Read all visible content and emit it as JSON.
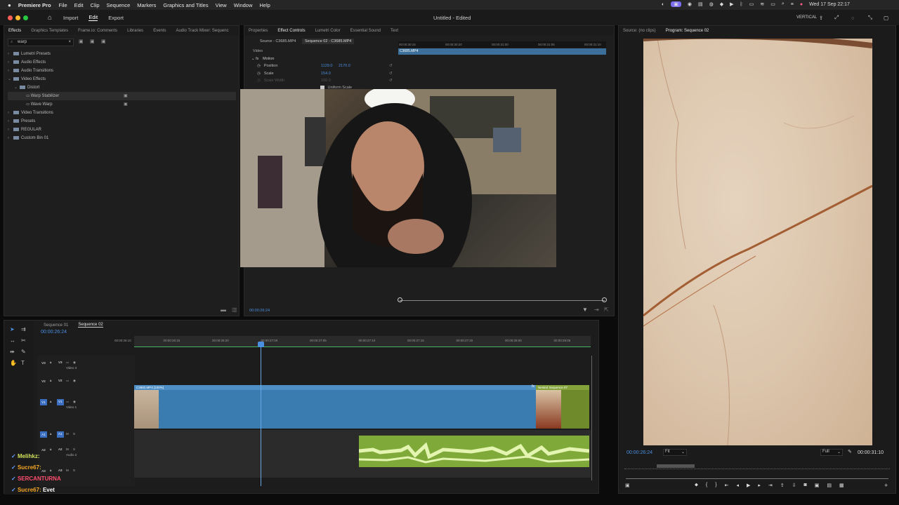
{
  "menubar": {
    "app": "Premiere Pro",
    "items": [
      "File",
      "Edit",
      "Clip",
      "Sequence",
      "Markers",
      "Graphics and Titles",
      "View",
      "Window",
      "Help"
    ],
    "right_label": "VERTICAL",
    "clock": "Wed 17 Sep  22:17"
  },
  "appbar": {
    "tabs": [
      "Import",
      "Edit",
      "Export"
    ],
    "active_tab": "Edit",
    "title": "Untitled - Edited"
  },
  "effects_panel": {
    "tabs": [
      "Effects",
      "Graphics Templates",
      "Frame.io: Comments",
      "Libraries",
      "Events",
      "Audio Track Mixer: Sequenc"
    ],
    "search_value": "warp",
    "tree": [
      {
        "label": "Lumetri Presets",
        "level": 0,
        "type": "folder",
        "open": false
      },
      {
        "label": "Audio Effects",
        "level": 0,
        "type": "folder",
        "open": false
      },
      {
        "label": "Audio Transitions",
        "level": 0,
        "type": "folder",
        "open": false
      },
      {
        "label": "Video Effects",
        "level": 0,
        "type": "folder",
        "open": true
      },
      {
        "label": "Distort",
        "level": 1,
        "type": "folder",
        "open": true
      },
      {
        "label": "Warp Stabilizer",
        "level": 2,
        "type": "effect",
        "selected": true
      },
      {
        "label": "Wave Warp",
        "level": 2,
        "type": "effect"
      },
      {
        "label": "Video Transitions",
        "level": 0,
        "type": "folder",
        "open": false
      },
      {
        "label": "Presets",
        "level": 0,
        "type": "folder",
        "open": false
      },
      {
        "label": "REGULAR",
        "level": 0,
        "type": "folder",
        "open": false
      },
      {
        "label": "Custom Bin 01",
        "level": 0,
        "type": "folder",
        "open": false
      }
    ]
  },
  "effect_controls": {
    "tabs": [
      "Properties",
      "Effect Controls",
      "Lumetri Color",
      "Essential Sound",
      "Text"
    ],
    "active_tab": "Effect Controls",
    "source_tab": "Source - C3685.MP4",
    "sequence_tab": "Sequence 02 - C3685.MP4",
    "clip_label": "C3685.MP4",
    "section": "Video",
    "motion": "Motion",
    "properties": [
      {
        "name": "Position",
        "value1": "1129.0",
        "value2": "2170.0"
      },
      {
        "name": "Scale",
        "value1": "154.0",
        "value2": ""
      },
      {
        "name": "Scale Width",
        "value1": "100.0",
        "value2": ""
      }
    ],
    "uniform_scale": "Uniform Scale",
    "ruler_ticks": [
      "00:00:30:15",
      "00:00:30:20",
      "00:00:31:00",
      "00:00:31:05",
      "00:00:31:10"
    ],
    "timecode": "00:00:26:24"
  },
  "program_monitor": {
    "source_tab": "Source: (no clips)",
    "program_tab": "Program: Sequence 02",
    "timecode": "00:00:26:24",
    "fit": "Fit",
    "resolution": "Full",
    "duration": "00:00:31:10"
  },
  "timeline": {
    "tabs": [
      "Sequence 01",
      "Sequence 02"
    ],
    "active_tab": "Sequence 02",
    "timecode": "00:00:26:24",
    "ruler_ticks": [
      "00:00:26:10",
      "00:00:26:15",
      "00:00:26:20",
      "00:00:27:00",
      "00:00:27:05",
      "00:00:27:10",
      "00:00:27:15",
      "00:00:27:20",
      "00:00:28:00",
      "00:00:28:05"
    ],
    "tracks": [
      {
        "id": "V3",
        "name": "Video 3"
      },
      {
        "id": "V2",
        "name": ""
      },
      {
        "id": "V1",
        "name": "Video 1"
      },
      {
        "id": "A1",
        "name": ""
      },
      {
        "id": "A2",
        "name": "Audio 2"
      },
      {
        "id": "A3",
        "name": ""
      }
    ],
    "clips": {
      "main": "C3682.MP4 [100%]",
      "nested": "Nested Sequence 07",
      "fx": "fx"
    },
    "colors": {
      "video_clip": "#3a7bb0",
      "nested_clip": "#6e8a2a",
      "audio_clip": "#7faa3a"
    }
  },
  "chat": [
    {
      "user": "Melihkz:",
      "message": "",
      "color": "#d4e35a"
    },
    {
      "user": "Sucre67:",
      "message": "",
      "color": "#f5a623"
    },
    {
      "user": "SERCANTURNA",
      "message": "",
      "color": "#ff4d6d"
    },
    {
      "user": "Sucre67:",
      "message": "Evet",
      "color": "#f5a623"
    }
  ]
}
